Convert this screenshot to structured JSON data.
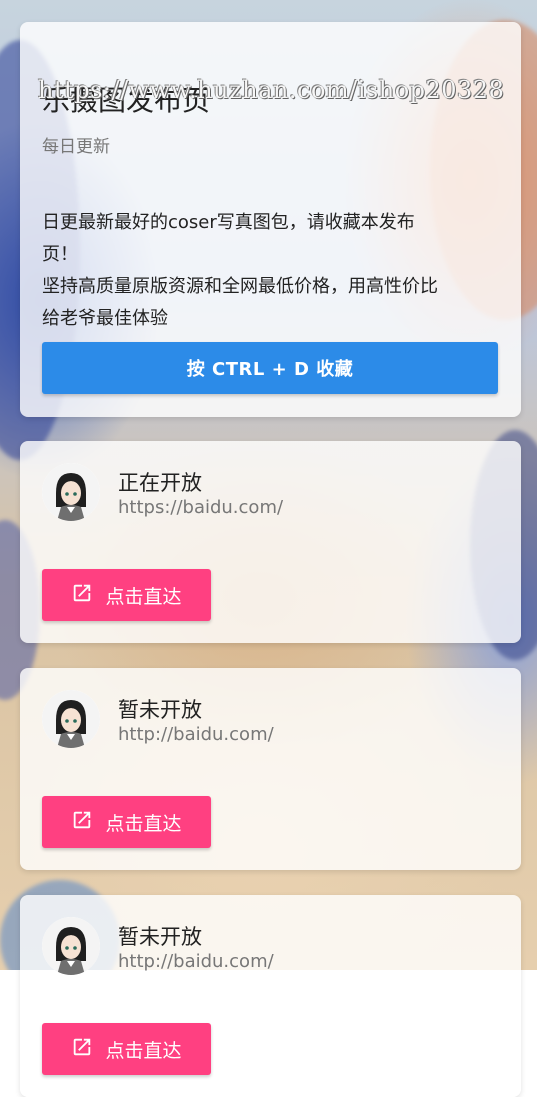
{
  "watermark": "https://www.huzhan.com/ishop20328",
  "hero": {
    "title": "乐摄图发布页",
    "subtitle": "每日更新",
    "description_lines": [
      "日更最新最好的coser写真图包，请收藏本发布",
      "页！",
      "坚持高质量原版资源和全网最低价格，用高性价比",
      "给老爷最佳体验"
    ],
    "bookmark_button": "按 CTRL + D 收藏"
  },
  "entries": [
    {
      "status": "正在开放",
      "url": "https://baidu.com/",
      "button": "点击直达",
      "avatar_icon": "avatar-girl-icon",
      "button_icon": "open-external-icon"
    },
    {
      "status": "暂未开放",
      "url": "http://baidu.com/",
      "button": "点击直达",
      "avatar_icon": "avatar-girl-icon",
      "button_icon": "open-external-icon"
    },
    {
      "status": "暂未开放",
      "url": "http://baidu.com/",
      "button": "点击直达",
      "avatar_icon": "avatar-girl-icon",
      "button_icon": "open-external-icon"
    }
  ],
  "colors": {
    "primary_button": "#2c8be8",
    "accent_button": "#ff4081"
  }
}
